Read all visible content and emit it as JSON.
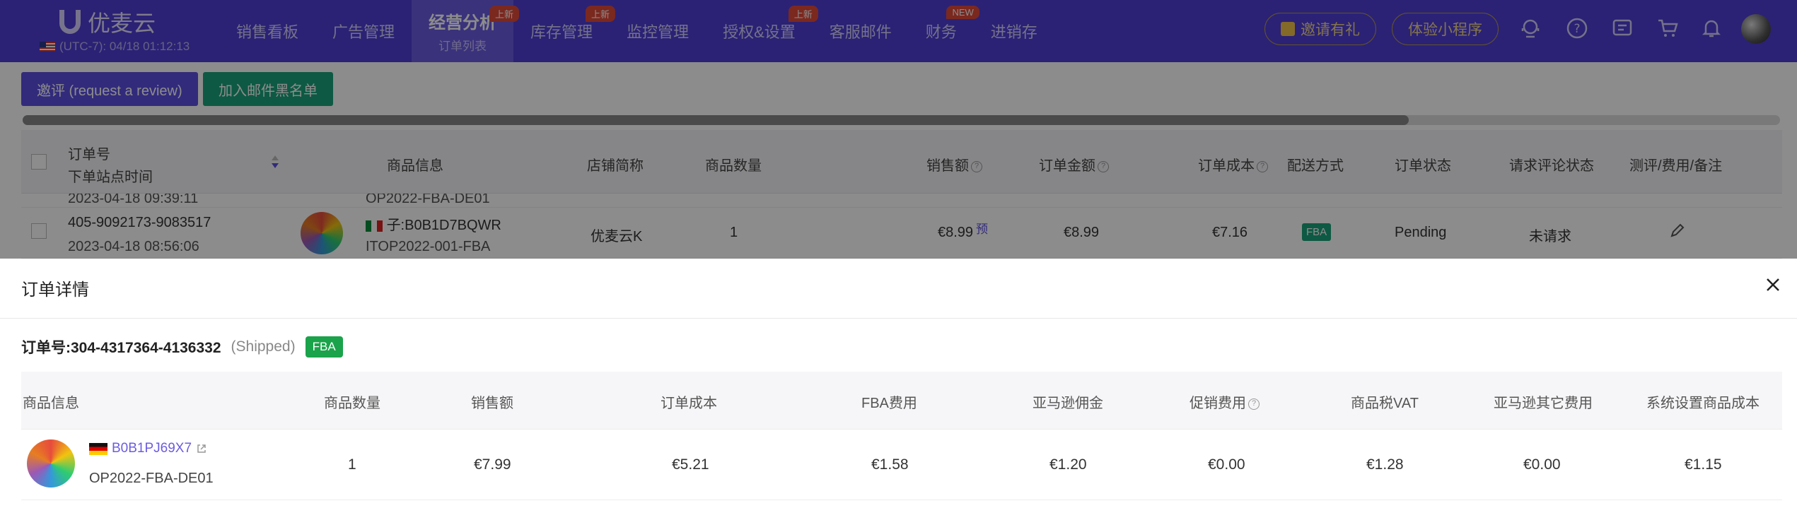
{
  "app": {
    "logo_text": "优麦云",
    "timezone": "(UTC-7): 04/18 01:12:13"
  },
  "nav": [
    {
      "label": "销售看板"
    },
    {
      "label": "广告管理"
    },
    {
      "label": "经营分析",
      "sub": "订单列表",
      "badge": "上新",
      "active": true
    },
    {
      "label": "库存管理",
      "badge": "上新"
    },
    {
      "label": "监控管理"
    },
    {
      "label": "授权&设置",
      "badge": "上新"
    },
    {
      "label": "客服邮件"
    },
    {
      "label": "财务",
      "badge": "NEW"
    },
    {
      "label": "进销存"
    }
  ],
  "header_actions": {
    "invite": "邀请有礼",
    "miniprogram": "体验小程序"
  },
  "toolbar": {
    "review_button": "邀评 (request a review)",
    "blacklist_button": "加入邮件黑名单"
  },
  "list_table": {
    "headers": {
      "order_no": "订单号",
      "order_time": "下单站点时间",
      "product": "商品信息",
      "store": "店铺简称",
      "qty": "商品数量",
      "sales": "销售额",
      "order_amount": "订单金额",
      "order_cost": "订单成本",
      "shipping": "配送方式",
      "status": "订单状态",
      "review_status": "请求评论状态",
      "remarks": "测评/费用/备注"
    },
    "rows": [
      {
        "time": "2023-04-18 09:39:11",
        "sku": "OP2022-FBA-DE01"
      },
      {
        "order_no": "405-9092173-9083517",
        "time": "2023-04-18 08:56:06",
        "asin": "子:B0B1D7BQWR",
        "sku": "ITOP2022-001-FBA",
        "store": "优麦云K",
        "qty": "1",
        "sales": "€8.99",
        "sales_tag": "预",
        "order_amount": "€8.99",
        "order_cost": "€7.16",
        "shipping": "FBA",
        "status": "Pending",
        "review_status": "未请求"
      }
    ]
  },
  "detail": {
    "title": "订单详情",
    "order_no": "订单号:304-4317364-4136332",
    "status": "(Shipped)",
    "channel": "FBA",
    "columns": [
      "商品信息",
      "商品数量",
      "销售额",
      "订单成本",
      "FBA费用",
      "亚马逊佣金",
      "促销费用",
      "商品税VAT",
      "亚马逊其它费用",
      "系统设置商品成本"
    ],
    "item": {
      "asin": "B0B1PJ69X7",
      "sku": "OP2022-FBA-DE01",
      "qty": "1",
      "sales": "€7.99",
      "order_cost": "€5.21",
      "fba_fee": "€1.58",
      "commission": "€1.20",
      "promotion": "€0.00",
      "vat": "€1.28",
      "other_fees": "€0.00",
      "system_cost": "€1.15"
    }
  },
  "colors": {
    "nav_bg": "#4f3fd6",
    "primary_button": "#5b4fe0",
    "green_button": "#1aa37a",
    "fba_green": "#1aa34a"
  }
}
